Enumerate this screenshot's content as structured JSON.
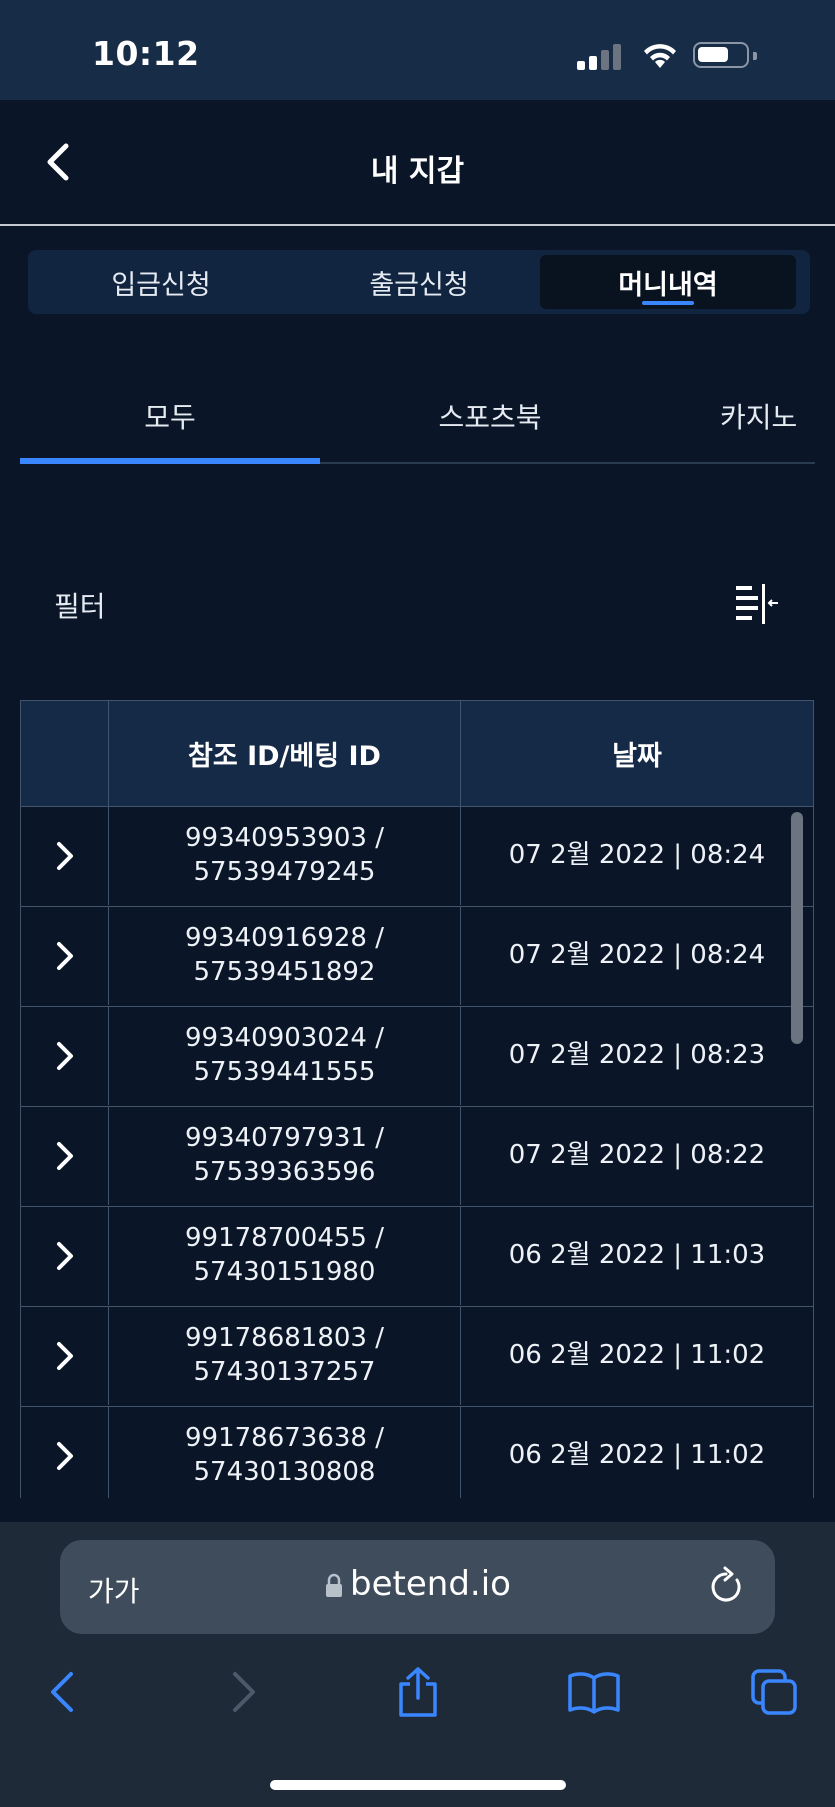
{
  "status": {
    "time": "10:12"
  },
  "header": {
    "title": "내 지갑"
  },
  "segments": [
    {
      "label": "입금신청",
      "active": false
    },
    {
      "label": "출금신청",
      "active": false
    },
    {
      "label": "머니내역",
      "active": true
    }
  ],
  "subtabs": [
    {
      "label": "모두",
      "active": true
    },
    {
      "label": "스포츠북",
      "active": false
    },
    {
      "label": "카지노",
      "active": false
    }
  ],
  "filter": {
    "label": "필터"
  },
  "table": {
    "columns": [
      "참조 ID/베팅 ID",
      "날짜"
    ],
    "rows": [
      {
        "ref_id": "99340953903 /",
        "bet_id": "57539479245",
        "date": "07 2월 2022 | 08:24"
      },
      {
        "ref_id": "99340916928 /",
        "bet_id": "57539451892",
        "date": "07 2월 2022 | 08:24"
      },
      {
        "ref_id": "99340903024 /",
        "bet_id": "57539441555",
        "date": "07 2월 2022 | 08:23"
      },
      {
        "ref_id": "99340797931 /",
        "bet_id": "57539363596",
        "date": "07 2월 2022 | 08:22"
      },
      {
        "ref_id": "99178700455 /",
        "bet_id": "57430151980",
        "date": "06 2월 2022 | 11:03"
      },
      {
        "ref_id": "99178681803 /",
        "bet_id": "57430137257",
        "date": "06 2월 2022 | 11:02"
      },
      {
        "ref_id": "99178673638 /",
        "bet_id": "57430130808",
        "date": "06 2월 2022 | 11:02"
      }
    ]
  },
  "browser": {
    "aa_label": "가가",
    "url": "betend.io"
  },
  "colors": {
    "accent": "#3a86ff",
    "background": "#0a1628",
    "header_cell": "#152a47"
  }
}
